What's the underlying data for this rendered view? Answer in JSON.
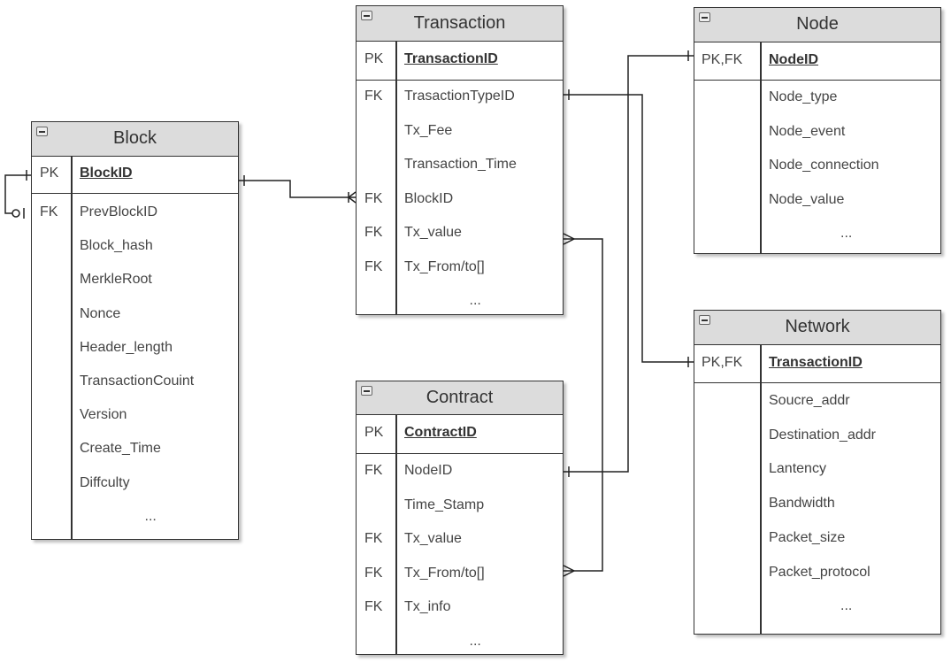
{
  "entities": [
    {
      "id": "block",
      "title": "Block",
      "pk": {
        "key": "PK",
        "name": "BlockID"
      },
      "rows": [
        {
          "key": "FK",
          "name": "PrevBlockID"
        },
        {
          "key": "",
          "name": "Block_hash"
        },
        {
          "key": "",
          "name": "MerkleRoot"
        },
        {
          "key": "",
          "name": "Nonce"
        },
        {
          "key": "",
          "name": "Header_length"
        },
        {
          "key": "",
          "name": "TransactionCouint"
        },
        {
          "key": "",
          "name": "Version"
        },
        {
          "key": "",
          "name": "Create_Time"
        },
        {
          "key": "",
          "name": "Diffculty"
        },
        {
          "key": "",
          "name": "..."
        }
      ]
    },
    {
      "id": "transaction",
      "title": "Transaction",
      "pk": {
        "key": "PK",
        "name": "TransactionID"
      },
      "rows": [
        {
          "key": "FK",
          "name": "TrasactionTypeID"
        },
        {
          "key": "",
          "name": "Tx_Fee"
        },
        {
          "key": "",
          "name": "Transaction_Time"
        },
        {
          "key": "FK",
          "name": "BlockID"
        },
        {
          "key": "FK",
          "name": "Tx_value"
        },
        {
          "key": "FK",
          "name": "Tx_From/to[]"
        },
        {
          "key": "",
          "name": "..."
        }
      ]
    },
    {
      "id": "contract",
      "title": "Contract",
      "pk": {
        "key": "PK",
        "name": "ContractID"
      },
      "rows": [
        {
          "key": "FK",
          "name": "NodeID"
        },
        {
          "key": "",
          "name": "Time_Stamp"
        },
        {
          "key": "FK",
          "name": "Tx_value"
        },
        {
          "key": "FK",
          "name": "Tx_From/to[]"
        },
        {
          "key": "FK",
          "name": "Tx_info"
        },
        {
          "key": "",
          "name": "..."
        }
      ]
    },
    {
      "id": "node",
      "title": "Node",
      "pk": {
        "key": "PK,FK",
        "name": "NodeID"
      },
      "rows": [
        {
          "key": "",
          "name": "Node_type"
        },
        {
          "key": "",
          "name": "Node_event"
        },
        {
          "key": "",
          "name": "Node_connection"
        },
        {
          "key": "",
          "name": "Node_value"
        },
        {
          "key": "",
          "name": "..."
        }
      ]
    },
    {
      "id": "network",
      "title": "Network",
      "pk": {
        "key": "PK,FK",
        "name": "TransactionID"
      },
      "rows": [
        {
          "key": "",
          "name": "Soucre_addr"
        },
        {
          "key": "",
          "name": "Destination_addr"
        },
        {
          "key": "",
          "name": "Lantency"
        },
        {
          "key": "",
          "name": "Bandwidth"
        },
        {
          "key": "",
          "name": "Packet_size"
        },
        {
          "key": "",
          "name": "Packet_protocol"
        },
        {
          "key": "",
          "name": "..."
        }
      ]
    }
  ],
  "relationships": [
    {
      "from": "Block.BlockID",
      "to": "Block.PrevBlockID",
      "from_end": "one",
      "to_end": "zero-or-one"
    },
    {
      "from": "Block.BlockID",
      "to": "Transaction.BlockID",
      "from_end": "one",
      "to_end": "one-or-many"
    },
    {
      "from": "Transaction.TrasactionTypeID",
      "to": "Network.TransactionID",
      "from_end": "one",
      "to_end": "one"
    },
    {
      "from": "Contract.NodeID",
      "to": "Node.NodeID",
      "from_end": "one",
      "to_end": "one"
    },
    {
      "from": "Transaction.Tx_value",
      "to": "Contract.Tx_From/to[]",
      "from_end": "many",
      "to_end": "many"
    }
  ]
}
